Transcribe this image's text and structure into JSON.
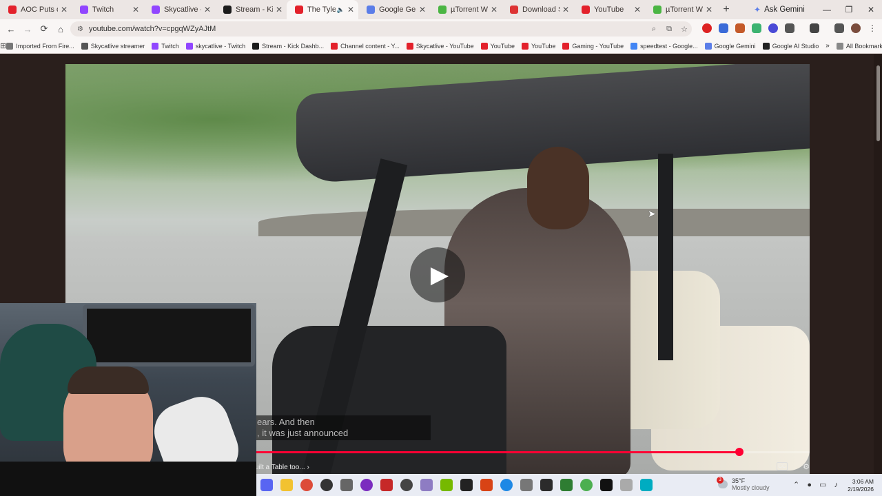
{
  "browser": {
    "tabs": [
      {
        "title": "AOC Puts on a",
        "fav_color": "#e3212b",
        "active": false
      },
      {
        "title": "Twitch",
        "fav_color": "#9146ff",
        "active": false
      },
      {
        "title": "Skycatlive - Twi",
        "fav_color": "#9146ff",
        "active": false
      },
      {
        "title": "Stream - Kick D",
        "fav_color": "#1b1b1b",
        "active": false
      },
      {
        "title": "The Tyler Pe",
        "fav_color": "#e3212b",
        "active": true
      },
      {
        "title": "Google Gemini",
        "fav_color": "#5b7de8",
        "active": false
      },
      {
        "title": "µTorrent Web",
        "fav_color": "#4bb543",
        "active": false
      },
      {
        "title": "Download Suck",
        "fav_color": "#d33",
        "active": false
      },
      {
        "title": "YouTube",
        "fav_color": "#e3212b",
        "active": false
      },
      {
        "title": "µTorrent Web",
        "fav_color": "#4bb543",
        "active": false
      }
    ],
    "ask_gemini": "Ask Gemini",
    "url": "youtube.com/watch?v=cpgqWZyAJtM",
    "bookmarks": [
      {
        "label": "Imported From Fire...",
        "color": "#777"
      },
      {
        "label": "Skycatlive streamer",
        "color": "#555"
      },
      {
        "label": "Twitch",
        "color": "#9146ff"
      },
      {
        "label": "skycatlive - Twitch",
        "color": "#9146ff"
      },
      {
        "label": "Stream - Kick Dashb...",
        "color": "#1b1b1b"
      },
      {
        "label": "Channel content - Y...",
        "color": "#e3212b"
      },
      {
        "label": "Skycatlive - YouTube",
        "color": "#e3212b"
      },
      {
        "label": "YouTube",
        "color": "#e3212b"
      },
      {
        "label": "YouTube",
        "color": "#e3212b"
      },
      {
        "label": "Gaming - YouTube",
        "color": "#e3212b"
      },
      {
        "label": "speedtest - Google...",
        "color": "#4285f4"
      },
      {
        "label": "Google Gemini",
        "color": "#5b7de8"
      },
      {
        "label": "Google AI Studio",
        "color": "#222"
      }
    ],
    "all_bookmarks": "All Bookmarks"
  },
  "video": {
    "caption_line1": "ears. And then",
    "caption_line2": ", it was just announced",
    "chapter": "uilt a Table too...",
    "progress_fraction": 0.873
  },
  "taskbar": {
    "weather_temp": "35°F",
    "weather_desc": "Mostly cloudy",
    "weather_badge": "3",
    "time": "3:06 AM",
    "date": "2/19/2026"
  }
}
